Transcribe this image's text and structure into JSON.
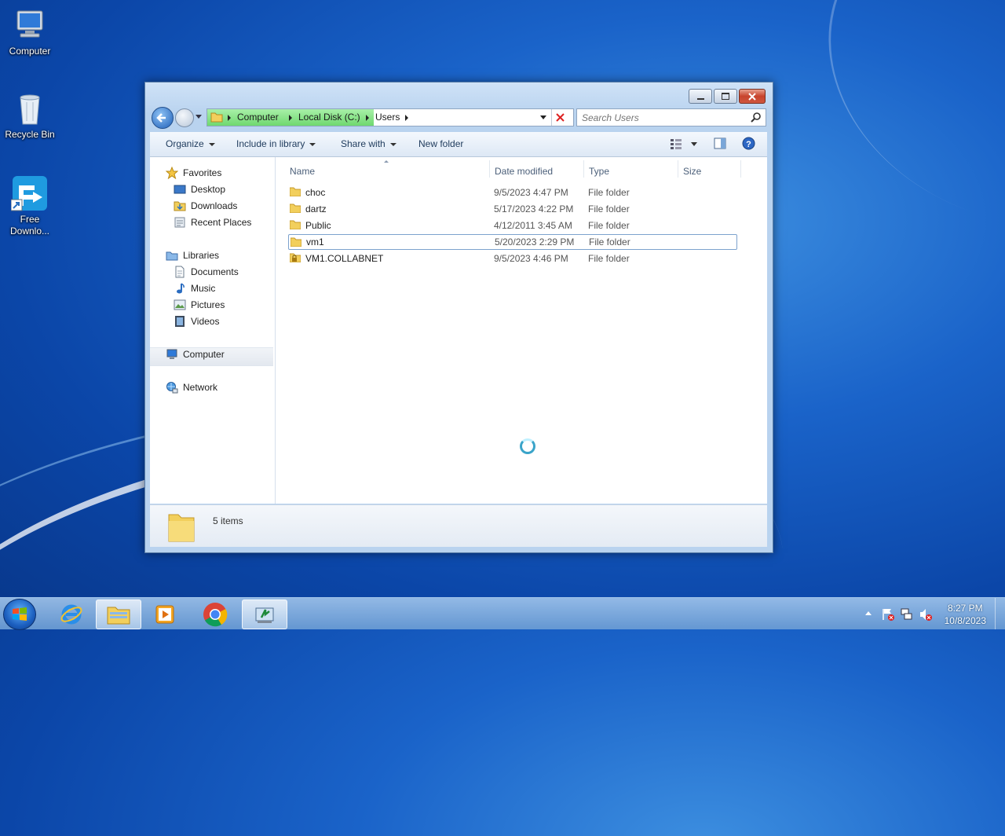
{
  "desktop": {
    "icons": [
      {
        "label": "Computer"
      },
      {
        "label": "Recycle Bin"
      },
      {
        "label": "Free Downlo..."
      }
    ]
  },
  "window": {
    "breadcrumb": [
      "Computer",
      "Local Disk (C:)",
      "Users"
    ],
    "search_placeholder": "Search Users",
    "toolbar": {
      "organize": "Organize",
      "include_in_library": "Include in library",
      "share_with": "Share with",
      "new_folder": "New folder"
    },
    "nav": {
      "favorites": "Favorites",
      "desktop": "Desktop",
      "downloads": "Downloads",
      "recent_places": "Recent Places",
      "libraries": "Libraries",
      "documents": "Documents",
      "music": "Music",
      "pictures": "Pictures",
      "videos": "Videos",
      "computer": "Computer",
      "network": "Network"
    },
    "columns": {
      "name": "Name",
      "date_modified": "Date modified",
      "type": "Type",
      "size": "Size"
    },
    "files": [
      {
        "name": "choc",
        "date": "9/5/2023 4:47 PM",
        "type": "File folder"
      },
      {
        "name": "dartz",
        "date": "5/17/2023 4:22 PM",
        "type": "File folder"
      },
      {
        "name": "Public",
        "date": "4/12/2011 3:45 AM",
        "type": "File folder"
      },
      {
        "name": "vm1",
        "date": "5/20/2023 2:29 PM",
        "type": "File folder"
      },
      {
        "name": "VM1.COLLABNET",
        "date": "9/5/2023 4:46 PM",
        "type": "File folder"
      }
    ],
    "status": {
      "item_count": "5 items"
    }
  },
  "taskbar": {
    "time": "8:27 PM",
    "date": "10/8/2023"
  },
  "colors": {
    "selection_border": "#7da2ce",
    "address_progress": "#6fd86f"
  }
}
